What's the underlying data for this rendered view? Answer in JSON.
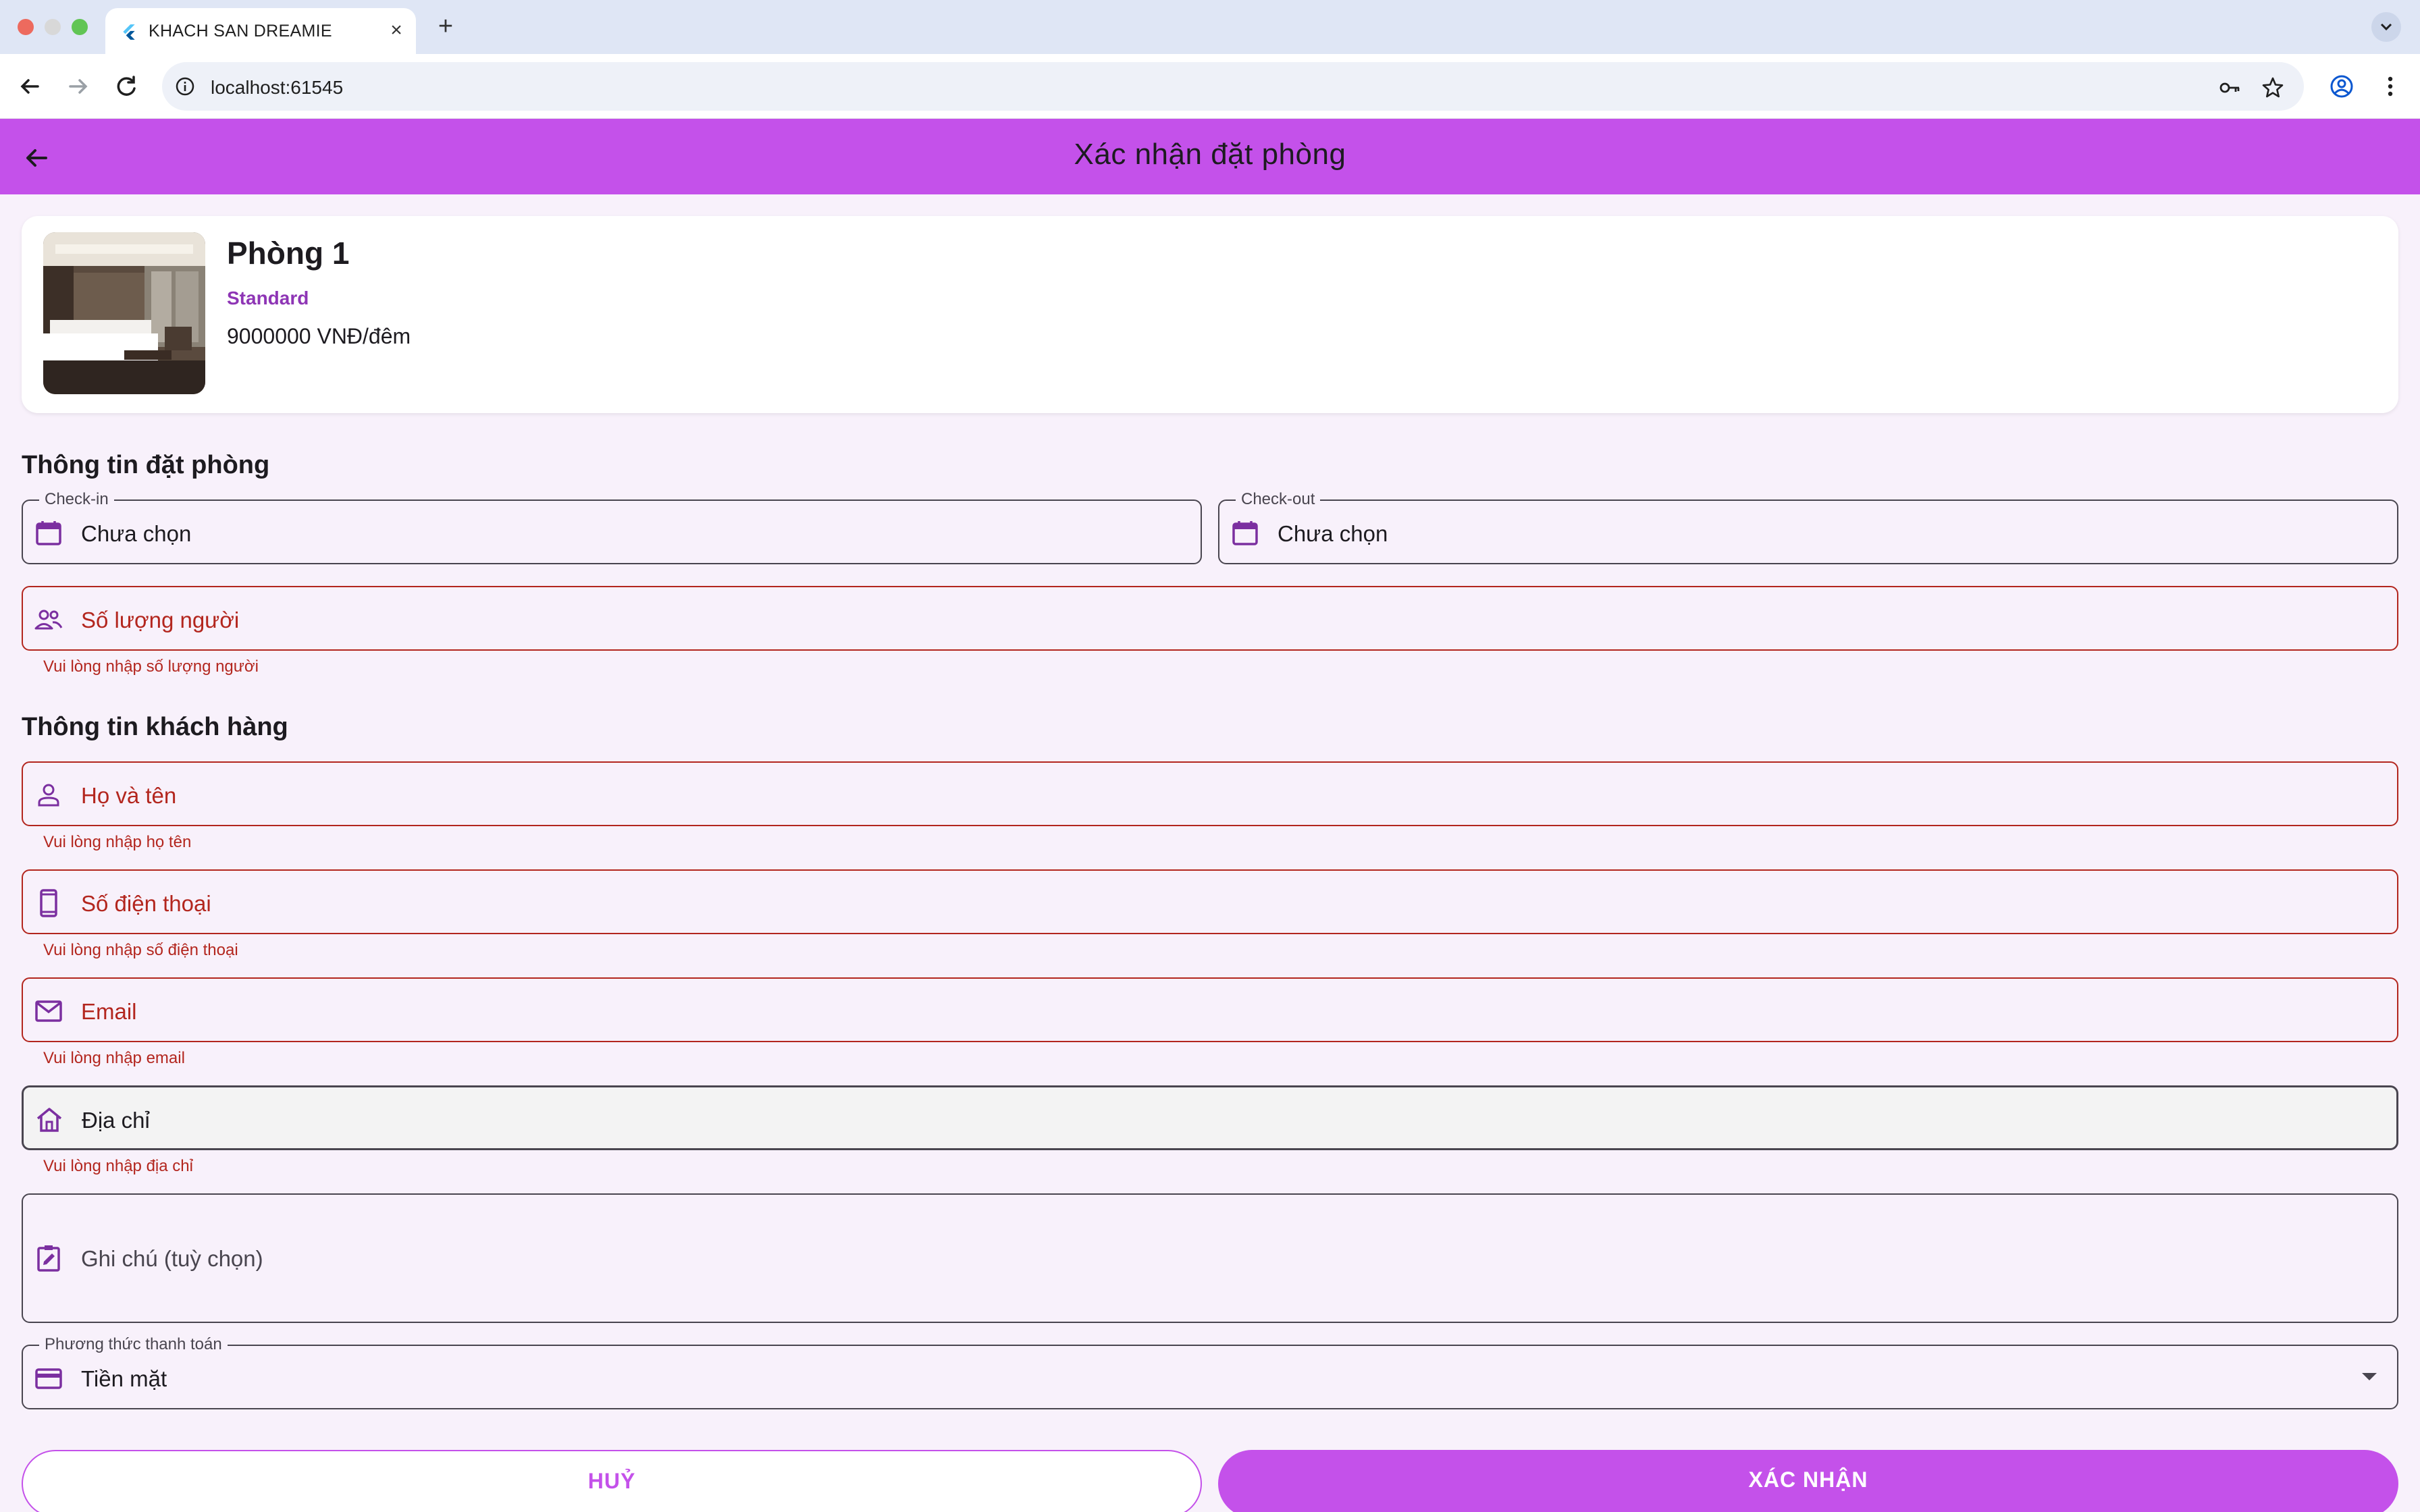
{
  "browser": {
    "tab_title": "KHACH SAN DREAMIE",
    "url": "localhost:61545"
  },
  "appbar": {
    "title": "Xác nhận đặt phòng"
  },
  "room": {
    "name": "Phòng 1",
    "type": "Standard",
    "price": "9000000 VNĐ/đêm"
  },
  "booking": {
    "section_title": "Thông tin đặt phòng",
    "checkin_label": "Check-in",
    "checkin_value": "Chưa chọn",
    "checkout_label": "Check-out",
    "checkout_value": "Chưa chọn",
    "guests_placeholder": "Số lượng người",
    "guests_error": "Vui lòng nhập số lượng người"
  },
  "customer": {
    "section_title": "Thông tin khách hàng",
    "name_placeholder": "Họ và tên",
    "name_error": "Vui lòng nhập họ tên",
    "phone_placeholder": "Số điện thoại",
    "phone_error": "Vui lòng nhập số điện thoại",
    "email_placeholder": "Email",
    "email_error": "Vui lòng nhập email",
    "address_placeholder": "Địa chỉ",
    "address_error": "Vui lòng nhập địa chỉ",
    "note_placeholder": "Ghi chú (tuỳ chọn)"
  },
  "payment": {
    "label": "Phương thức thanh toán",
    "selected": "Tiền mặt"
  },
  "actions": {
    "cancel_label": "HUỶ",
    "confirm_label": "XÁC NHẬN"
  },
  "colors": {
    "primary": "#c451ea",
    "accent_text": "#8e35b5",
    "error": "#b3261e",
    "background": "#f8f1fb"
  },
  "icons": {
    "appbar_back": "arrow-left-icon",
    "checkin": "calendar-icon",
    "checkout": "calendar-icon",
    "guests": "people-icon",
    "name": "person-icon",
    "phone": "smartphone-icon",
    "email": "mail-icon",
    "address": "home-icon",
    "note": "edit-note-icon",
    "payment": "credit-card-icon"
  }
}
